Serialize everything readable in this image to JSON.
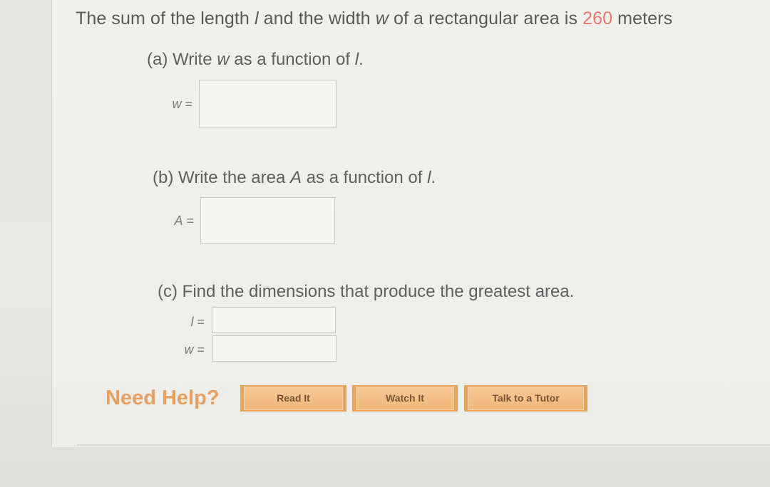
{
  "question": {
    "prefix": "The sum of the length ",
    "var_l": "l",
    "mid1": " and the width ",
    "var_w": "w",
    "mid2": " of a rectangular area is ",
    "value": "260",
    "suffix": " meters"
  },
  "part_a": {
    "label_before": "(a) Write ",
    "var": "w",
    "label_after": " as a function of ",
    "var2": "l",
    "label_end": ".",
    "eq_var": "w",
    "eq_sign": " =",
    "value": ""
  },
  "part_b": {
    "label_before": "(b) Write the area ",
    "var": "A",
    "label_after": " as a function of ",
    "var2": "l",
    "label_end": ".",
    "eq_var": "A",
    "eq_sign": " =",
    "value": ""
  },
  "part_c": {
    "label": "(c) Find the dimensions that produce the greatest area.",
    "eq1_var": "l",
    "eq1_sign": " =",
    "eq1_value": "",
    "eq2_var": "w",
    "eq2_sign": " =",
    "eq2_value": ""
  },
  "help": {
    "label": "Need Help?",
    "read_it": "Read It",
    "watch_it": "Watch It",
    "talk_to_tutor": "Talk to a Tutor"
  },
  "colors": {
    "given_value": "#e8786d",
    "help_label": "#e8a060",
    "help_button": "#f0b878"
  }
}
